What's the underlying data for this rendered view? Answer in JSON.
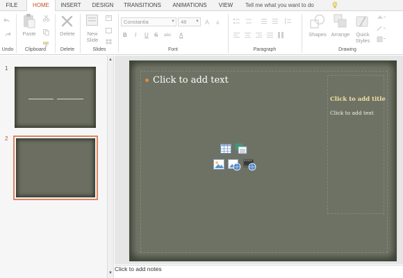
{
  "tabs": [
    {
      "label": "FILE",
      "active": false
    },
    {
      "label": "HOME",
      "active": true
    },
    {
      "label": "INSERT",
      "active": false
    },
    {
      "label": "DESIGN",
      "active": false
    },
    {
      "label": "TRANSITIONS",
      "active": false
    },
    {
      "label": "ANIMATIONS",
      "active": false
    },
    {
      "label": "VIEW",
      "active": false
    }
  ],
  "tell_me": "Tell me what you want to do",
  "ribbon": {
    "groups": {
      "undo": "Undo",
      "clipboard": "Clipboard",
      "delete": "Delete",
      "slides": "Slides",
      "font": "Font",
      "paragraph": "Paragraph",
      "drawing": "Drawing"
    },
    "buttons": {
      "paste": "Paste",
      "delete": "Delete",
      "new_slide_1": "New",
      "new_slide_2": "Slide",
      "shapes": "Shapes",
      "arrange": "Arrange",
      "quick_styles_1": "Quick",
      "quick_styles_2": "Styles"
    },
    "font_name": "Constantia",
    "font_size": "48",
    "format": {
      "bold": "B",
      "italic": "I",
      "underline": "U",
      "strike": "S",
      "shadow": "abc",
      "font_color": "A"
    }
  },
  "thumbnails": [
    {
      "number": "1",
      "selected": false
    },
    {
      "number": "2",
      "selected": true
    }
  ],
  "slide": {
    "body_placeholder": "Click to add text",
    "side_title": "Click to add title",
    "side_text": "Click to add text"
  },
  "notes_placeholder": "Click to add notes",
  "colors": {
    "accent": "#c4502a",
    "bullet": "#e6893c",
    "slide_bg": "#6e7265",
    "title_gold": "#f2e2a0"
  }
}
